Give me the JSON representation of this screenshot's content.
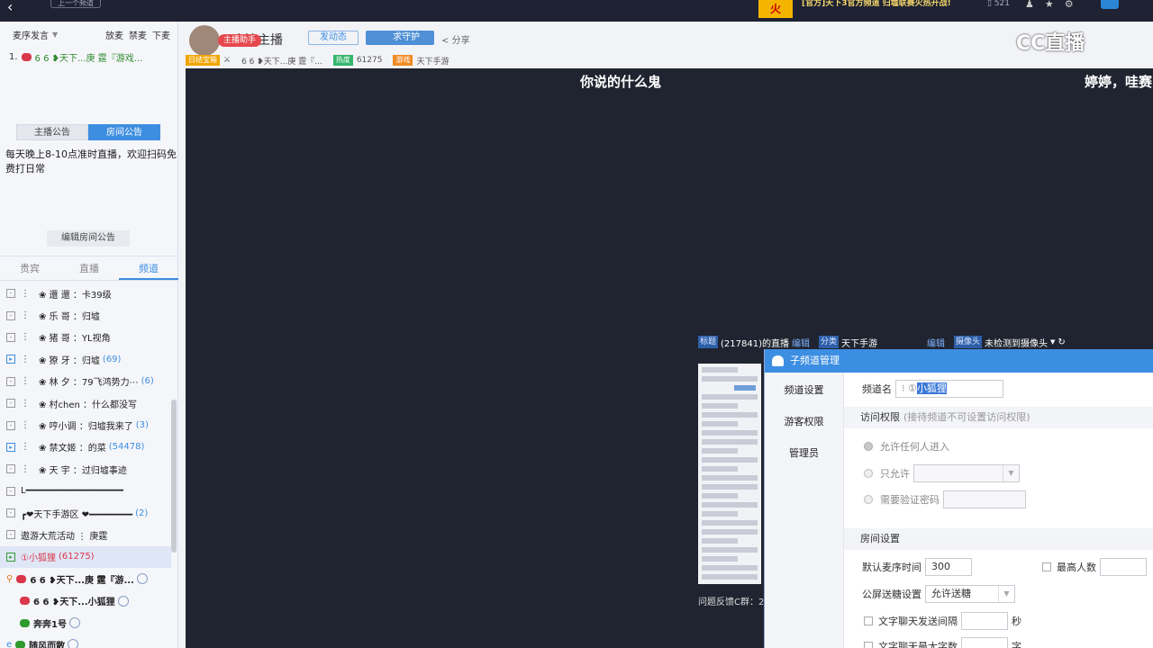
{
  "topbar": {
    "back_icon": "back-arrow-icon",
    "prev_channel": "上一个频道",
    "news": "[官方]天下3官方频道 归墟联赛火热开战!",
    "viewers": "521",
    "thumb_text": "火"
  },
  "cc_logo": "CC直播",
  "left": {
    "mic_mode": "麦序发言",
    "mic_actions": [
      "放麦",
      "禁麦",
      "下麦"
    ],
    "queue": [
      {
        "num": "1.",
        "name": "6 6 ❥天下...庚 霆『游戏..."
      }
    ],
    "announce_tabs": [
      "主播公告",
      "房间公告"
    ],
    "announce_active": 1,
    "announce_text": "每天晚上8-10点准时直播，欢迎扫码免费打日常",
    "edit_announce": "编辑房间公告",
    "section_tabs": [
      "贵宾",
      "直播",
      "频道"
    ],
    "section_active": 2,
    "channels": [
      {
        "box": "-",
        "text": "❀ 還  還 ：卡39级",
        "count": ""
      },
      {
        "box": "-",
        "text": "❀ 乐  哥 ：归墟",
        "count": ""
      },
      {
        "box": "-",
        "text": "❀ 猪  哥 ：YL视角",
        "count": ""
      },
      {
        "box": "▸",
        "text": "❀ 獠  牙 ：归墟",
        "count": "(69)"
      },
      {
        "box": "-",
        "text": "❀ 林  夕 ：79飞鸿势力⋯",
        "count": "(6)"
      },
      {
        "box": "-",
        "text": "❀ 村chen ：什么都没写",
        "count": ""
      },
      {
        "box": "-",
        "text": "❀ 哼小调 ：归墟我来了",
        "count": "(3)"
      },
      {
        "box": "▸",
        "text": "❀ 禁文姬 ：的菜",
        "count": "(54478)"
      },
      {
        "box": "-",
        "text": "❀ 天  宇 ：过归墟事迹",
        "count": ""
      },
      {
        "box": "-",
        "text": "L━━━━━━━━━━━━━━━━━━",
        "count": ""
      },
      {
        "box": "-",
        "text": "┏❤天下手游区 ❤━━━━━━━━",
        "count": "(2)"
      },
      {
        "box": "-",
        "text": "遨游大荒活动 ⋮ 庚霆",
        "count": ""
      }
    ],
    "selected_channel": {
      "text": "①小狐狸",
      "count": "(61275)"
    },
    "users": [
      {
        "name": "6 6 ❥天下...庚 霆『游..."
      },
      {
        "name": "6 6 ❥天下...小狐狸"
      },
      {
        "name": "奔奔1号"
      },
      {
        "name": "随风而散"
      }
    ]
  },
  "header": {
    "helper_tag": "主播助手",
    "anchor_name": "小流主播",
    "btn_dynamic": "发动态",
    "btn_guard": "求守护",
    "btn_share": "分享",
    "meta_tag1": "日结宝箱",
    "meta_room": "6 6 ❥天下...庚 霆『...",
    "meta_hot_tag": "热度",
    "meta_hot": "61275",
    "meta_game_tag": "游戏",
    "meta_game": "天下手游"
  },
  "video": {
    "danmu": [
      "你说的什么鬼",
      "婷婷，哇赛"
    ],
    "bar": {
      "title_label": "标题",
      "title_value": "(217841)的直播",
      "edit1": "编辑",
      "cat_label": "分类",
      "cat_value": "天下手游",
      "edit2": "编辑",
      "cam_label": "摄像头",
      "cam_value": "未检测到摄像头"
    },
    "feedback": "问题反馈C群：2"
  },
  "dialog": {
    "title": "子频道管理",
    "side_items": [
      "频道设置",
      "游客权限",
      "管理员"
    ],
    "channel_name_label": "频道名",
    "channel_name_prefix": "⁝ ①",
    "channel_name_selected": "小狐狸",
    "access_title": "访问权限",
    "access_hint": "(接待频道不可设置访问权限)",
    "opt_all": "允许任何人进入",
    "opt_only": "只允许",
    "opt_password": "需要验证密码",
    "room_title": "房间设置",
    "mic_time_label": "默认麦序时间",
    "mic_time_value": "300",
    "max_people_label": "最高人数",
    "gift_label": "公屏送糖设置",
    "gift_value": "允许送糖",
    "text_interval_label": "文字聊天发送间隔",
    "text_interval_unit": "秒",
    "text_max_label": "文字聊天最大字数",
    "text_max_unit": "字"
  }
}
